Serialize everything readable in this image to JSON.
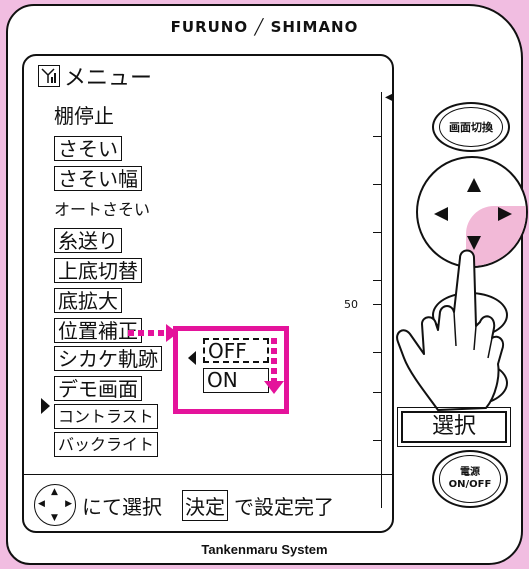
{
  "brand": "FURUNO ╱ SHIMANO",
  "footer_brand": "Tankenmaru System",
  "screen": {
    "title": "メニュー",
    "gauge_label": "50",
    "menu_items": [
      {
        "label": "棚停止",
        "boxed": false
      },
      {
        "label": "さそい",
        "boxed": true
      },
      {
        "label": "さそい幅",
        "boxed": true
      },
      {
        "label": "オートさそい",
        "boxed": false
      },
      {
        "label": "糸送り",
        "boxed": true
      },
      {
        "label": "上底切替",
        "boxed": true
      },
      {
        "label": "底拡大",
        "boxed": true
      },
      {
        "label": "位置補正",
        "boxed": true
      },
      {
        "label": "シカケ軌跡",
        "boxed": true,
        "selected": true
      },
      {
        "label": "デモ画面",
        "boxed": true
      },
      {
        "label": "コントラスト",
        "boxed": true
      },
      {
        "label": "バックライト",
        "boxed": true
      }
    ],
    "popup_options": [
      "OFF",
      "ON"
    ],
    "popup_selected": "OFF",
    "footer": {
      "select_text": "にて選択",
      "confirm_word": "決定",
      "confirm_text": "で設定完了"
    }
  },
  "buttons": {
    "screen_switch": "画面切換",
    "select": "選択",
    "power_line1": "電源",
    "power_line2": "ON/OFF"
  },
  "colors": {
    "background": "#f1bde1",
    "accent": "#e4139b",
    "dpad_highlight": "#f2b9d7"
  }
}
